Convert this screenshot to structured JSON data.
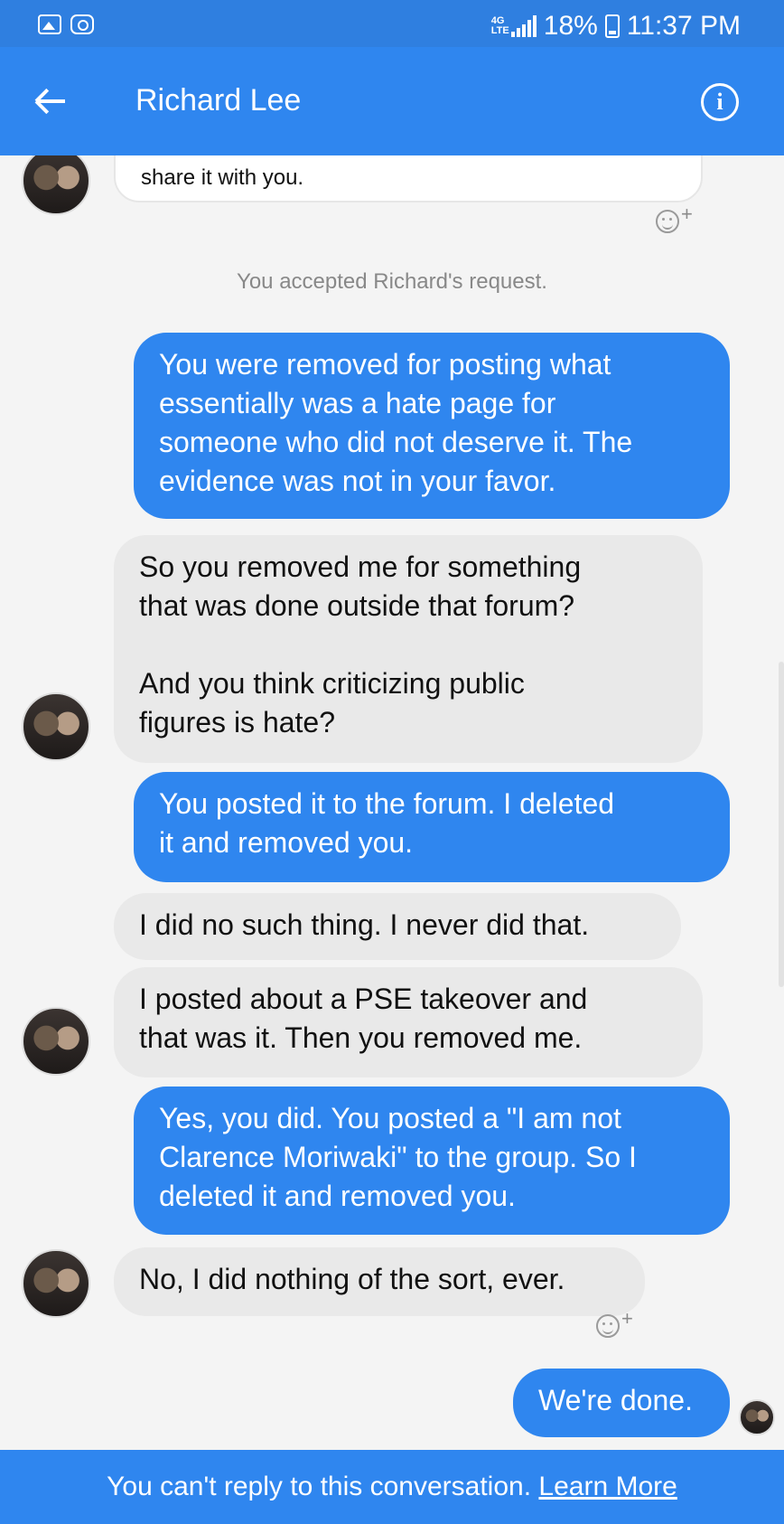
{
  "status_bar": {
    "network": "4G LTE",
    "battery": "18%",
    "time": "11:37 PM",
    "icons": [
      "gallery-icon",
      "instagram-icon",
      "signal-icon",
      "battery-icon"
    ]
  },
  "header": {
    "contact_name": "Richard Lee",
    "back_icon": "back-arrow-icon",
    "info_icon": "info-icon"
  },
  "messages": [
    {
      "from": "them",
      "text": "share it with you."
    },
    {
      "from": "system",
      "text": "You accepted Richard's request."
    },
    {
      "from": "me",
      "text": "You were removed for posting what\nessentially was a hate page for\nsomeone who did not deserve it. The\nevidence was not in your favor."
    },
    {
      "from": "them",
      "text": "So you removed me for something\nthat was done outside that forum?\n\nAnd you think criticizing public\nfigures is hate?"
    },
    {
      "from": "me",
      "text": "You posted it to the forum. I deleted\nit and removed you."
    },
    {
      "from": "them",
      "text": "I did no such thing.  I never did that."
    },
    {
      "from": "them",
      "text": "I posted about a PSE takeover and\nthat was it.  Then you removed me."
    },
    {
      "from": "me",
      "text": "Yes, you did. You posted a \"I am not\nClarence Moriwaki\" to the group. So I\ndeleted it and removed you."
    },
    {
      "from": "them",
      "text": "No, I did nothing of the sort, ever."
    },
    {
      "from": "me",
      "text": "We're done."
    }
  ],
  "footer": {
    "notice": "You can't reply to this conversation.",
    "link": "Learn More"
  },
  "colors": {
    "brand_blue": "#2f86ef",
    "incoming_bubble": "#e9e9e9",
    "background": "#f4f4f4"
  }
}
